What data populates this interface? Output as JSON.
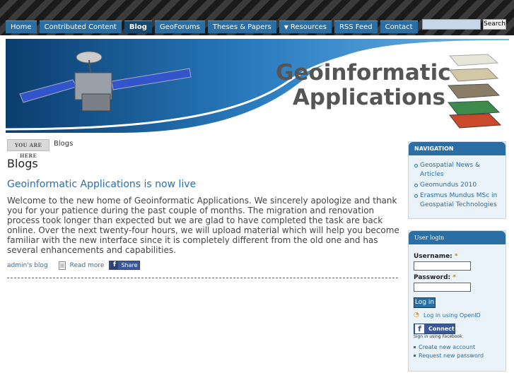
{
  "nav": {
    "tabs": [
      {
        "label": "Home"
      },
      {
        "label": "Contributed Content"
      },
      {
        "label": "Blog"
      },
      {
        "label": "GeoForums"
      },
      {
        "label": "Theses & Papers"
      },
      {
        "label": "Resources"
      },
      {
        "label": "RSS Feed"
      },
      {
        "label": "Contact"
      }
    ],
    "active": "Blog"
  },
  "search": {
    "value": "",
    "button_label": "Search"
  },
  "banner": {
    "line1": "Geoinformatic",
    "line2": "Applications"
  },
  "breadcrumb": {
    "label": "YOU ARE HERE",
    "current": "Blogs"
  },
  "page_title": "Blogs",
  "post": {
    "title": "Geoinformatic Applications is now live",
    "body": "Welcome to the new home of Geoinformatic Applications. We sincerely apologize and thank you for your patience during the past couple of months. The migration and renovation process took longer than expected but we are glad to have completed the task are back online. Over the next twenty-four hours, we will upload material which will help you become familiar with the new interface since it is completely different from the old one and has several enhancements and capabilities.",
    "blog_link": "admin's blog",
    "read_more": "Read more",
    "share": "Share"
  },
  "navigation_block": {
    "title": "NAVIGATION",
    "items": [
      {
        "label": "Geospatial News & Articles"
      },
      {
        "label": "Geomundus 2010"
      },
      {
        "label": "Erasmus Mundus MSc in Geospatial Technologies"
      }
    ]
  },
  "login_block": {
    "title": "User login",
    "username_label": "Username:",
    "password_label": "Password:",
    "required_mark": "*",
    "login_button": "Log in",
    "openid_link": "Log in using OpenID",
    "fb_connect": "Connect",
    "fb_sub": "Sign in using Facebook",
    "links": [
      {
        "label": "Create new account"
      },
      {
        "label": "Request new password"
      }
    ]
  },
  "colors": {
    "nav_tab": "#2a6ea3",
    "nav_active": "#17486f",
    "link": "#2b6ea8",
    "facebook": "#3b5998"
  }
}
